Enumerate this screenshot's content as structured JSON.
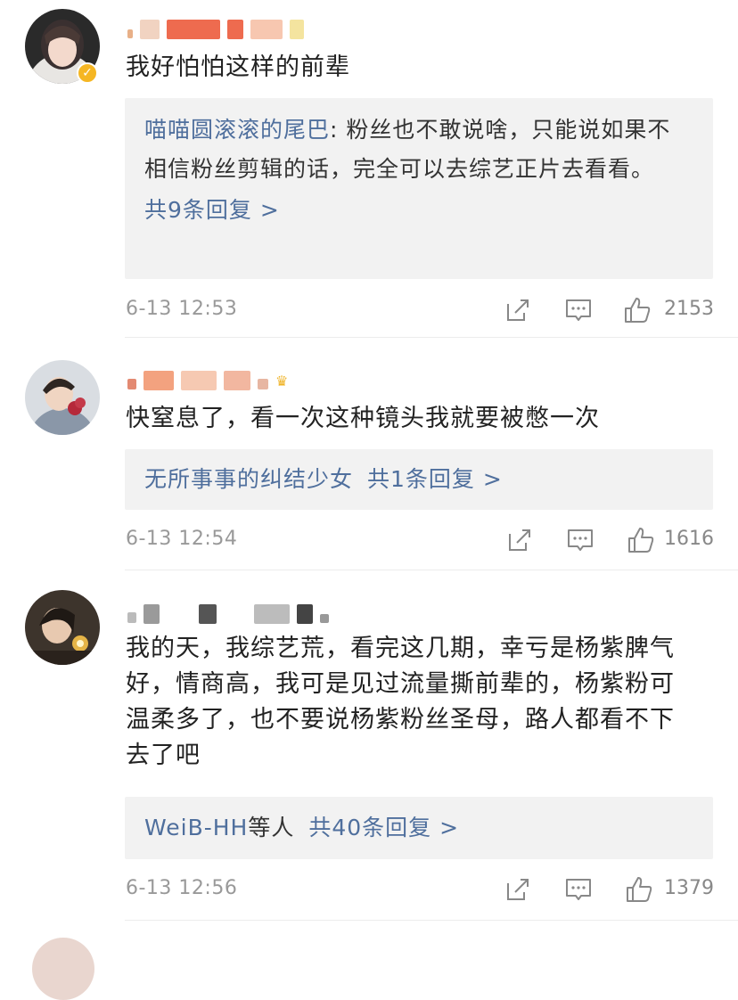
{
  "comments": [
    {
      "text": "我好怕怕这样的前辈",
      "reply": {
        "author": "喵喵圆滚滚的尾巴",
        "separator": ": ",
        "content": "粉丝也不敢说啥，只能说如果不相信粉丝剪辑的话，完全可以去综艺正片去看看。",
        "more": "共9条回复 >"
      },
      "date": "6-13 12:53",
      "likes": "2153"
    },
    {
      "text": "快窒息了，看一次这种镜头我就要被憋一次",
      "reply": {
        "author": "无所事事的纠结少女",
        "more": "共1条回复 >"
      },
      "date": "6-13 12:54",
      "likes": "1616"
    },
    {
      "text": "我的天，我综艺荒，看完这几期，幸亏是杨紫脾气好，情商高，我可是见过流量撕前辈的，杨紫粉可温柔多了，也不要说杨紫粉丝圣母，路人都看不下去了吧",
      "reply": {
        "author": "WeiB-HH",
        "author_suffix": "等人",
        "more": "共40条回复 >"
      },
      "date": "6-13 12:56",
      "likes": "1379"
    }
  ],
  "icons": {
    "share": "share-icon",
    "comment": "comment-icon",
    "like": "like-icon",
    "verified": "verified-badge-icon",
    "crown": "crown-icon"
  },
  "colors": {
    "link": "#4f6f9d",
    "reply_bg": "#f2f2f2",
    "badge": "#f5b623",
    "meta": "#999999"
  }
}
